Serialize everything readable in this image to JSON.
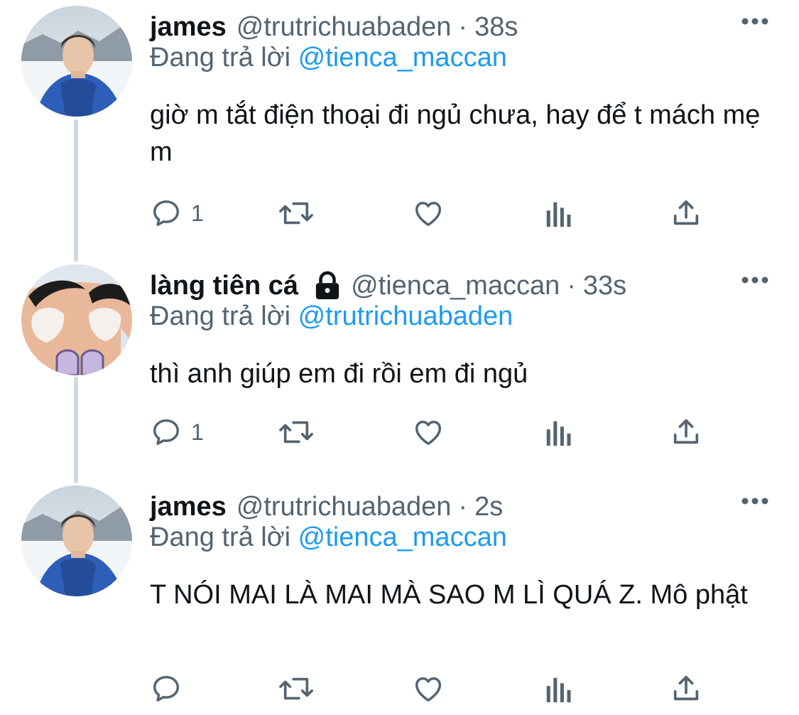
{
  "tweets": [
    {
      "name": "james",
      "locked": false,
      "handle": "@trutrichuabaden",
      "separator": "·",
      "time": "38s",
      "replying_label": "Đang trả lời",
      "replying_to": "@tienca_maccan",
      "text": "giờ m tắt điện thoại đi ngủ chưa, hay để t mách mẹ m",
      "reply_count": "1",
      "avatar": "photo-person-blue-jacket"
    },
    {
      "name": "làng tiên cá",
      "locked": true,
      "handle": "@tienca_maccan",
      "separator": "·",
      "time": "33s",
      "replying_label": "Đang trả lời",
      "replying_to": "@trutrichuabaden",
      "text": "thì anh giúp em đi rồi em đi ngủ",
      "reply_count": "1",
      "avatar": "cartoon-eyebrows-closeup"
    },
    {
      "name": "james",
      "locked": false,
      "handle": "@trutrichuabaden",
      "separator": "·",
      "time": "2s",
      "replying_label": "Đang trả lời",
      "replying_to": "@tienca_maccan",
      "text": "T NÓI MAI LÀ MAI MÀ SAO M LÌ QUÁ Z. Mô phật",
      "reply_count": "",
      "avatar": "photo-person-blue-jacket"
    }
  ],
  "icons": {
    "reply": "speech-bubble-icon",
    "retweet": "retweet-icon",
    "like": "heart-icon",
    "views": "analytics-bars-icon",
    "share": "share-upload-icon",
    "more": "more-dots-icon",
    "lock": "lock-icon"
  },
  "colors": {
    "text": "#0f1419",
    "secondary": "#536471",
    "link": "#1d9bf0",
    "thread_line": "#cfd9de"
  }
}
